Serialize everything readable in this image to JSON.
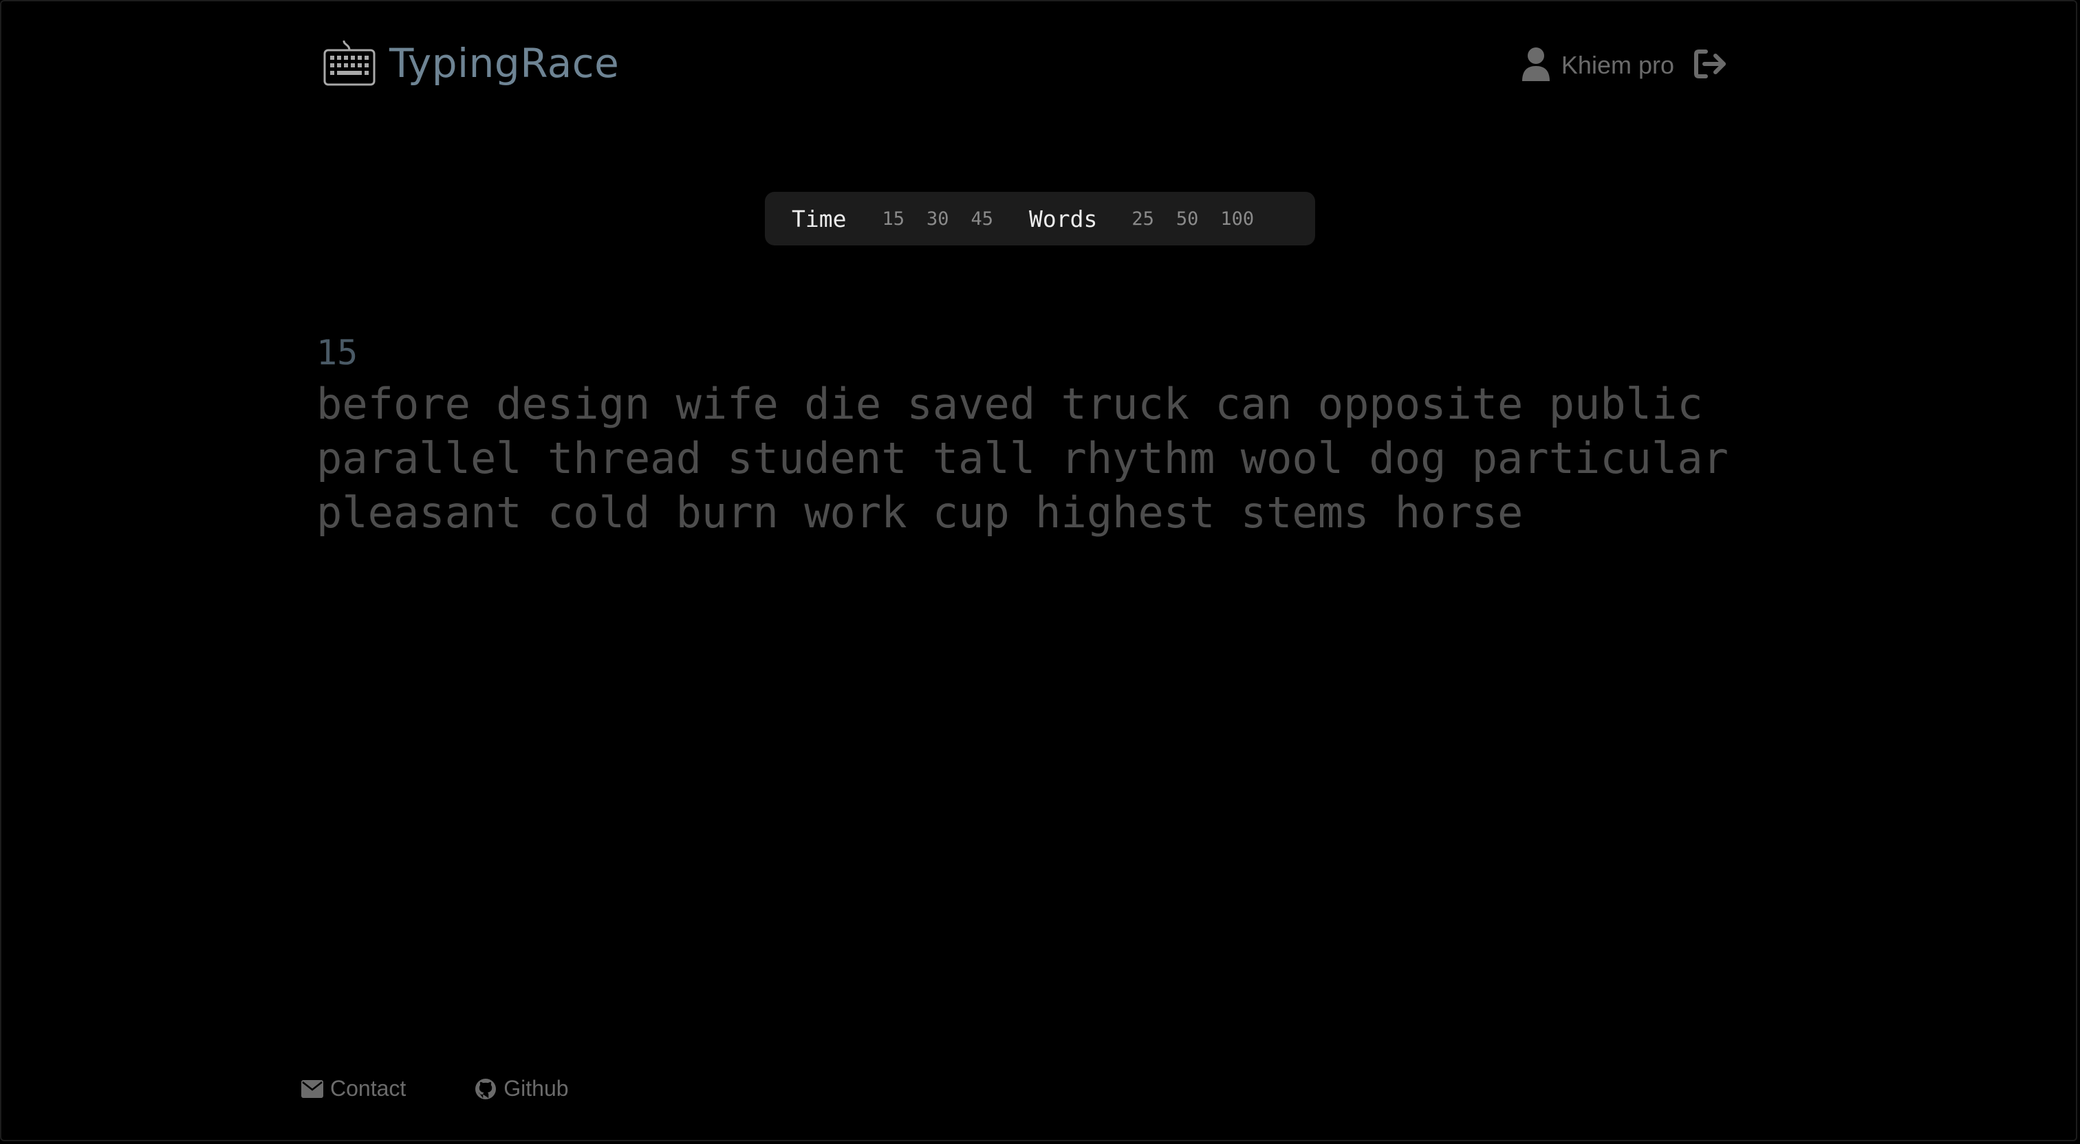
{
  "header": {
    "app_name": "TypingRace",
    "user_name": "Khiem pro"
  },
  "mode_selector": {
    "time_label": "Time",
    "time_options": [
      "15",
      "30",
      "45"
    ],
    "words_label": "Words",
    "word_options": [
      "25",
      "50",
      "100"
    ]
  },
  "test": {
    "timer": "15",
    "lines": [
      "before design wife die saved truck can opposite public",
      "parallel thread student tall rhythm wool dog particular",
      "pleasant cold burn work cup highest stems horse"
    ]
  },
  "footer": {
    "contact_label": "Contact",
    "github_label": "Github"
  },
  "colors": {
    "background": "#000000",
    "accent": "#6e8494",
    "text_untyped": "#4d4d4d",
    "mode_bar": "#1c1c1c"
  }
}
